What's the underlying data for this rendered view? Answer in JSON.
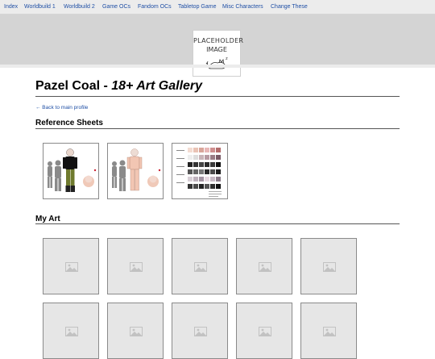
{
  "nav": {
    "links": [
      "Index",
      "Worldbuild 1",
      "Worldbuild 2",
      "Game OCs",
      "Fandom OCs",
      "Tabletop Game",
      "Misc Characters",
      "Change These"
    ]
  },
  "banner": {
    "logo_line1": "PLACEHOLDER",
    "logo_line2": "IMAGE"
  },
  "page": {
    "title_main": "Pazel Coal - ",
    "title_italic": "18+ Art Gallery",
    "back_link": "← Back to main profile"
  },
  "sections": {
    "reference": "Reference Sheets",
    "my_art": "My Art"
  },
  "colors": {
    "nav_bg": "#ececec",
    "banner_bg": "#d4d4d4",
    "link": "#1f4fa5",
    "placeholder_bg": "#e6e6e6"
  },
  "icons": {
    "placeholder": "image-placeholder-icon",
    "logo": "cat-icon"
  }
}
